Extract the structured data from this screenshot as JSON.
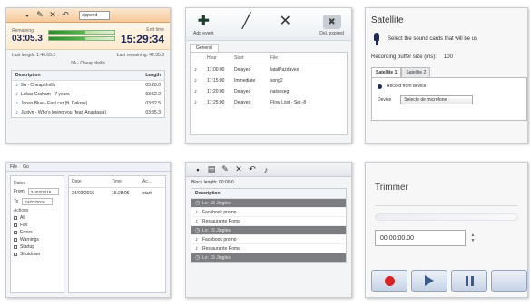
{
  "player": {
    "select": "Append",
    "remaining_label": "Remaining",
    "remaining_value": "03:05.3",
    "end_label": "End time",
    "end_value": "15:29:34",
    "last_length": "Last length: 1:46:03.2",
    "last_remaining": "Last remaining: 42:35.8",
    "now_playing": "9A - Cheap thrills",
    "col_description": "Description",
    "col_length": "Length",
    "items": [
      {
        "name": "9A - Cheap thrills",
        "length": "03:28.0"
      },
      {
        "name": "Lukas Graham - 7 years",
        "length": "03:52.2"
      },
      {
        "name": "Jonas Blue - Fast car (ft. Dakota)",
        "length": "03:32.5"
      },
      {
        "name": "Justyn - Who's loving you (feat. Anastasia)",
        "length": "03:35.3"
      }
    ]
  },
  "events": {
    "btn_add": "Add event",
    "btn_del": "Del. expired",
    "tab": "General",
    "cols": [
      "Hour",
      "Start",
      "File"
    ],
    "rows": [
      {
        "hour": "17:00:00",
        "start": "Delayed",
        "file": "latalPazdaves"
      },
      {
        "hour": "17:15:00",
        "start": "Immediate",
        "file": "song2"
      },
      {
        "hour": "17:20:00",
        "start": "Delayed",
        "file": "natseseg"
      },
      {
        "hour": "17:25:00",
        "start": "Delayed",
        "file": "Flow Lost - Ser.-8"
      }
    ]
  },
  "satellite": {
    "title": "Satellite",
    "instruction": "Select the sound cards that will be us",
    "buffer_label": "Recording buffer size (ms):",
    "buffer_value": "100",
    "tab1": "Satellite 1",
    "tab2": "Satellite 2",
    "record_label": "Record from device",
    "device_label": "Device",
    "device_value": "Selecte de microfone"
  },
  "explorer": {
    "menu": [
      "File",
      "Go"
    ],
    "dates_label": "Dates",
    "from_label": "From",
    "from_value": "24/03/2016",
    "to_label": "To",
    "to_value": "24/03/2016",
    "actions_label": "Actions",
    "actions": [
      "All",
      "Fav",
      "Errors",
      "Warnings",
      "Startup",
      "Shutdown"
    ],
    "cols": [
      "Date",
      "Time",
      "Ac..."
    ],
    "row": {
      "date": "24/03/2016",
      "time": "15:28:05",
      "action": "start"
    }
  },
  "playlist": {
    "block_length": "Block length: 00:00.0",
    "col_description": "Description",
    "items": [
      {
        "name": "Lo: 15 Jingles",
        "dark": true
      },
      {
        "name": "Facebook promo",
        "dark": false
      },
      {
        "name": "Restaurante Roma",
        "dark": false
      },
      {
        "name": "Lo: 15 Jingles",
        "dark": true
      },
      {
        "name": "Facebook promo",
        "dark": false
      },
      {
        "name": "Restaurante Roma",
        "dark": false
      },
      {
        "name": "Lo: 15 Jingles",
        "dark": true
      }
    ]
  },
  "trimmer": {
    "title": "Trimmer",
    "time_value": "00:00:00.00"
  }
}
